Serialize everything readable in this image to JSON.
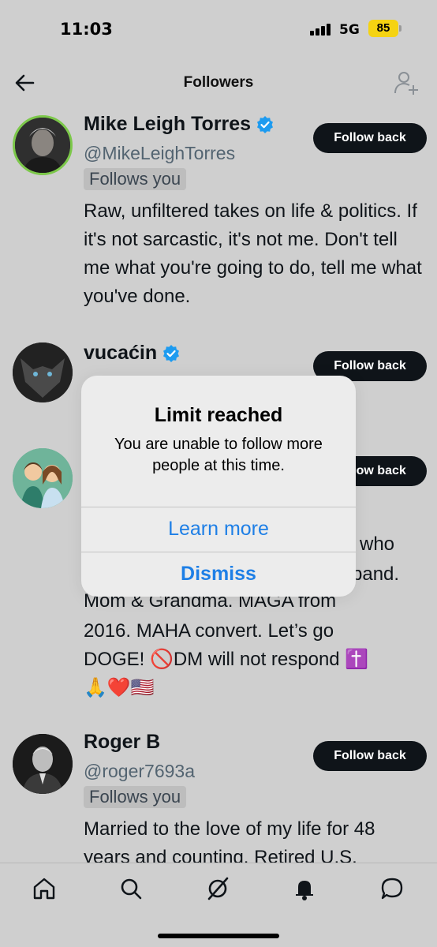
{
  "status": {
    "time": "11:03",
    "network": "5G",
    "battery": "85"
  },
  "nav": {
    "title": "Followers"
  },
  "followers": [
    {
      "name": "Mike Leigh Torres",
      "handle": "@MikeLeighTorres",
      "follows_you": "Follows you",
      "bio": "Raw, unfiltered takes on life & politics. If it's not sarcastic, it's not me. Don't tell me what you're going to do, tell me what you've done.",
      "button": "Follow back"
    },
    {
      "name": "vucaćin",
      "button": "Follow back"
    },
    {
      "button": "Follow back",
      "bio_lines": [
        "who",
        "band.",
        "Mom & Grandma. MAGA from",
        "2016. MAHA convert. Let’s go",
        "DOGE! 🚫DM will not respond ✝️",
        "🙏❤️🇺🇸"
      ]
    },
    {
      "name": "Roger B",
      "handle": "@roger7693a",
      "follows_you": "Follows you",
      "bio": "Married to the love of my life for 48 years and counting. Retired U.S.",
      "button": "Follow back"
    }
  ],
  "dialog": {
    "title": "Limit reached",
    "message": "You are unable to follow more people at this time.",
    "primary_action": "Learn more",
    "dismiss_action": "Dismiss"
  },
  "bottom_nav": [
    "home-icon",
    "search-icon",
    "grok-icon",
    "notifications-icon",
    "messages-icon"
  ],
  "colors": {
    "accent": "#1e7fe6",
    "verified": "#1d9bf0",
    "button_bg": "#0f1419",
    "battery": "#f5d312"
  }
}
